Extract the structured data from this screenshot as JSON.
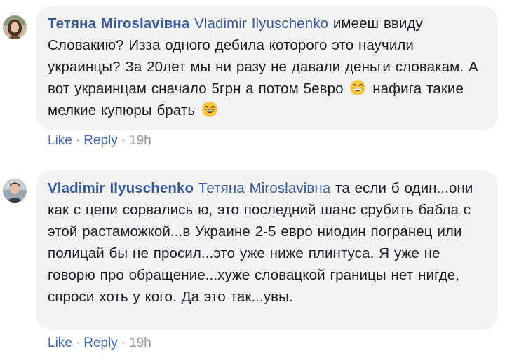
{
  "comments": [
    {
      "author": "Тетяна Miroslavівна",
      "mention": "Vladimir Ilyuschenko",
      "text_before_emoji": " имееш ввиду Словакию? Изза одного дебила которого это научили украинцы? За 20лет мы ни разу не давали деньги словакам. А вот украинцам сначало 5грн а потом 5евро",
      "text_between_emoji": " нафига такие мелкие купюры брать",
      "emoji": "grinning-face-with-smiling-eyes",
      "actions": {
        "like": "Like",
        "reply": "Reply",
        "separator": "·",
        "time": "19h"
      }
    },
    {
      "author": "Vladimir Ilyuschenko",
      "mention": "Тетяна Miroslavівна",
      "text": " та если б один...они как с цепи сорвались ю, это последний шанс срубить бабла с этой растаможкой...в Украине 2-5 евро ниодин погранец или полицай бы не просил...это уже ниже плинтуса. Я уже не говорю про обращение...хуже словацкой границы нет нигде, спроси хоть у кого. Да это так...увы.",
      "actions": {
        "like": "Like",
        "reply": "Reply",
        "separator": "·",
        "time": "19h"
      }
    }
  ],
  "colors": {
    "bubble": "#f2f3f5",
    "name_link": "#385898",
    "action_link": "#4267b2",
    "meta": "#90949c"
  }
}
